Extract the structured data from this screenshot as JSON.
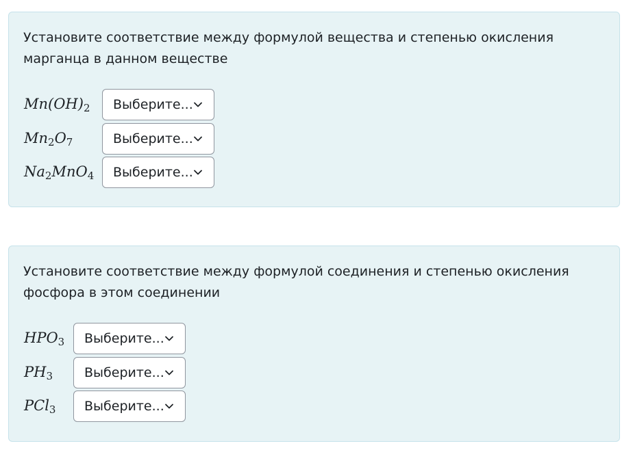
{
  "questions": [
    {
      "text": "Установите соответствие между формулой вещества и степенью окисления марганца в данном веществе",
      "rows": [
        {
          "formula_parts": [
            {
              "t": "Mn(OH)"
            },
            {
              "sub": "2"
            }
          ],
          "select": "Выберите..."
        },
        {
          "formula_parts": [
            {
              "t": "Mn"
            },
            {
              "sub": "2"
            },
            {
              "t": "O"
            },
            {
              "sub": "7"
            }
          ],
          "select": "Выберите..."
        },
        {
          "formula_parts": [
            {
              "t": "Na"
            },
            {
              "sub": "2"
            },
            {
              "t": "MnO"
            },
            {
              "sub": "4"
            }
          ],
          "select": "Выберите..."
        }
      ]
    },
    {
      "text": "Установите соответствие между формулой соединения и степенью окисления фосфора в этом соединении",
      "rows": [
        {
          "formula_parts": [
            {
              "t": "HPO"
            },
            {
              "sub": "3"
            }
          ],
          "select": "Выберите..."
        },
        {
          "formula_parts": [
            {
              "t": "PH"
            },
            {
              "sub": "3"
            }
          ],
          "select": "Выберите..."
        },
        {
          "formula_parts": [
            {
              "t": "PCl"
            },
            {
              "sub": "3"
            }
          ],
          "select": "Выберите..."
        }
      ]
    }
  ],
  "colors": {
    "card_bg": "#e7f3f5",
    "card_border": "#c6e2ea",
    "text": "#1d2125",
    "select_border": "#8f959e"
  },
  "icons": {
    "dropdown": "chevron-down-icon"
  }
}
